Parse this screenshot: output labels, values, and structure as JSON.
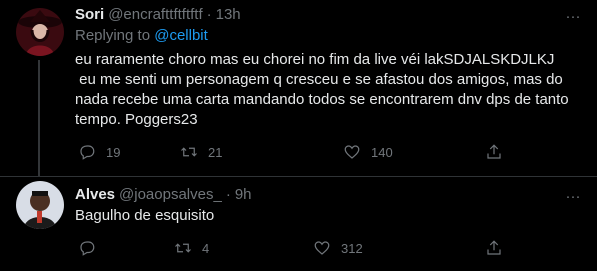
{
  "tweets": [
    {
      "display_name": "Sori",
      "handle": "@encrafttftftftf",
      "separator": "·",
      "time": "13h",
      "more_label": "···",
      "reply_prefix": "Replying to ",
      "reply_mention": "@cellbit",
      "text": "eu raramente choro mas eu chorei no fim da live véi lakSDJALSKDJLKJ\n eu me senti um personagem q cresceu e se afastou dos amigos, mas do nada recebe uma carta mandando todos se encontrarem dnv dps de tanto tempo. Poggers23",
      "replies": "19",
      "retweets": "21",
      "likes": "140",
      "icons": [
        "reply-icon",
        "retweet-icon",
        "heart-icon",
        "share-icon"
      ]
    },
    {
      "display_name": "Alves",
      "handle": "@joaopsalves_",
      "separator": "·",
      "time": "9h",
      "more_label": "···",
      "text": "Bagulho de esquisito",
      "retweets": "4",
      "likes": "312",
      "icons": [
        "reply-icon",
        "retweet-icon",
        "heart-icon",
        "share-icon"
      ]
    }
  ],
  "colors": {
    "background": "#000000",
    "text": "#e7e9ea",
    "muted": "#71767b",
    "link": "#1d9bf0",
    "divider": "#2f3336"
  }
}
